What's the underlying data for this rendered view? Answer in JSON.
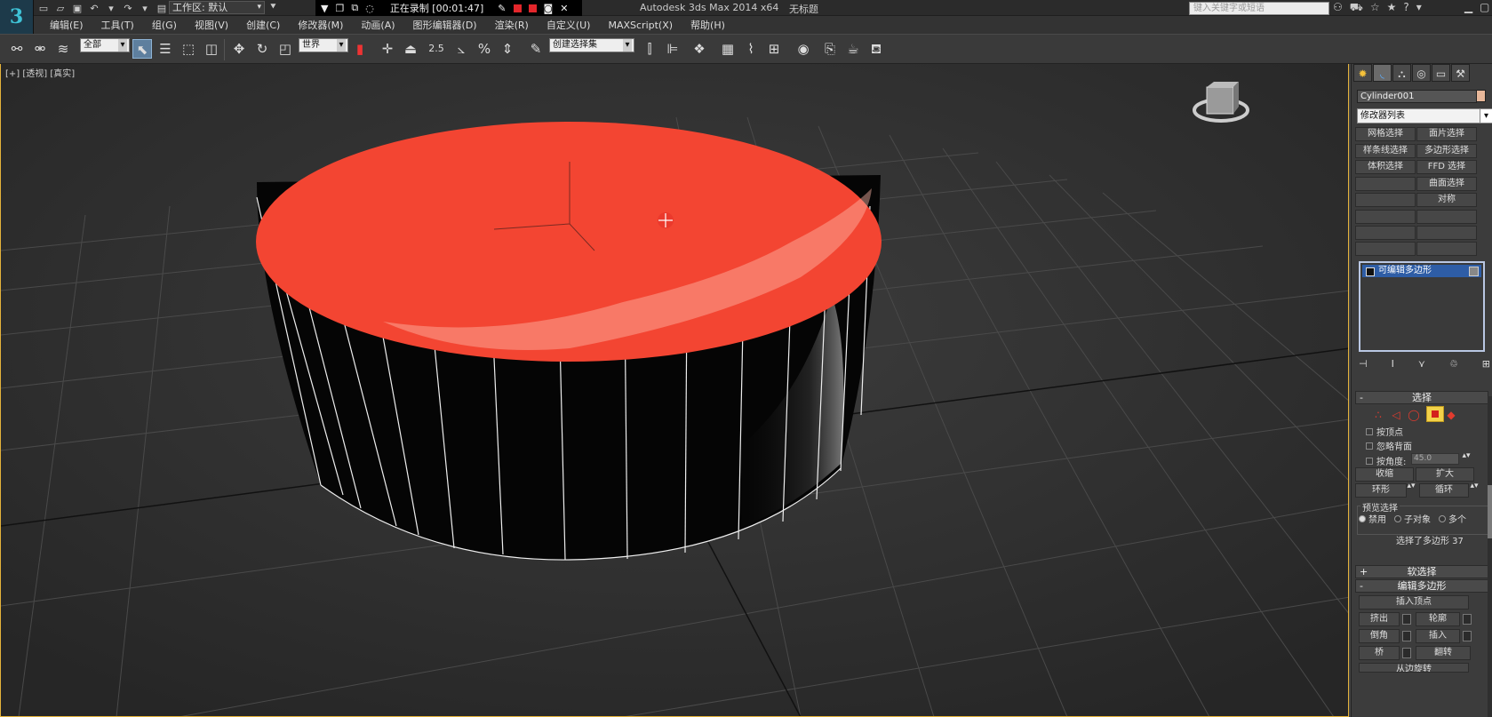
{
  "titlebar": {
    "workspace_label": "工作区: 默认",
    "recording_text": "正在录制 [00:01:47]",
    "app_title": "Autodesk 3ds Max  2014 x64",
    "document": "无标题",
    "search_placeholder": "键入关键字或短语",
    "help_label": "?"
  },
  "menu": [
    "编辑(E)",
    "工具(T)",
    "组(G)",
    "视图(V)",
    "创建(C)",
    "修改器(M)",
    "动画(A)",
    "图形编辑器(D)",
    "渲染(R)",
    "自定义(U)",
    "MAXScript(X)",
    "帮助(H)"
  ],
  "toolbar": {
    "selection_filter": "全部",
    "ref_coord": "世界",
    "snap_value": "2.5",
    "named_sel_set": "创建选择集"
  },
  "viewport": {
    "label": "[+] [透视] [真实]"
  },
  "colors": {
    "accent": "#e5b33b",
    "top_face": "#f34532",
    "stack_highlight": "#2e5da6",
    "object_color": "#e8b89a"
  },
  "panel": {
    "object_name": "Cylinder001",
    "modifier_list": "修改器列表",
    "mod_buttons": [
      {
        "label": "网格选择"
      },
      {
        "label": "面片选择"
      },
      {
        "label": "样条线选择"
      },
      {
        "label": "多边形选择"
      },
      {
        "label": "体积选择"
      },
      {
        "label": "FFD 选择"
      },
      {
        "label": ""
      },
      {
        "label": "曲面选择"
      },
      {
        "label": ""
      },
      {
        "label": "对称"
      }
    ],
    "stack_item": "可编辑多边形",
    "selection_rollout": "选择",
    "by_vertex": "按顶点",
    "ignore_backface": "忽略背面",
    "by_angle": "按角度:",
    "angle_value": "45.0",
    "shrink": "收缩",
    "grow": "扩大",
    "ring": "环形",
    "loop": "循环",
    "preview_selection": "预览选择",
    "preview_opts": [
      "禁用",
      "子对象",
      "多个"
    ],
    "selection_status": "选择了多边形 37",
    "soft_selection": "软选择",
    "edit_polygons": "编辑多边形",
    "insert_vertex": "插入顶点",
    "extrude": "挤出",
    "outline": "轮廓",
    "bevel": "倒角",
    "inset": "插入",
    "bridge": "桥",
    "flip": "翻转",
    "from_edge": "从边旋转"
  }
}
